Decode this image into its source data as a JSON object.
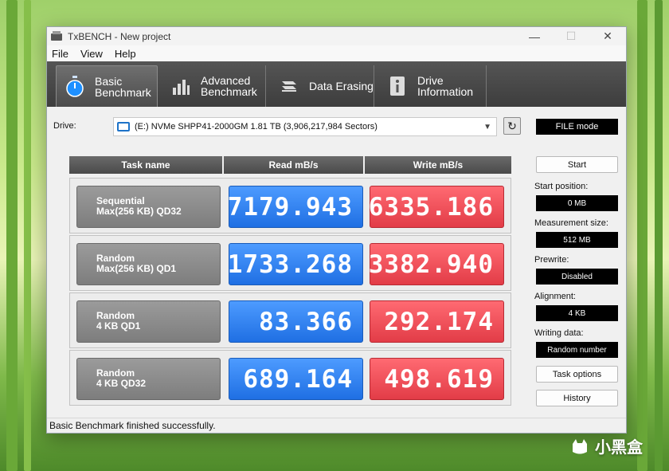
{
  "window": {
    "title": "TxBENCH - New project"
  },
  "menu": [
    "File",
    "View",
    "Help"
  ],
  "tabs": [
    {
      "line1": "Basic",
      "line2": "Benchmark",
      "icon": "stopwatch-icon",
      "active": true
    },
    {
      "line1": "Advanced",
      "line2": "Benchmark",
      "icon": "bar-chart-icon",
      "active": false
    },
    {
      "line1": "Data Erasing",
      "line2": "",
      "icon": "eraser-icon",
      "active": false
    },
    {
      "line1": "Drive",
      "line2": "Information",
      "icon": "info-icon",
      "active": false
    }
  ],
  "drive": {
    "label": "Drive:",
    "selected": "(E:) NVMe SHPP41-2000GM  1.81 TB (3,906,217,984 Sectors)"
  },
  "mode": "FILE mode",
  "table": {
    "headers": [
      "Task name",
      "Read mB/s",
      "Write mB/s"
    ],
    "rows": [
      {
        "task_line1": "Sequential",
        "task_line2": "Max(256 KB) QD32",
        "read": "7179.943",
        "write": "6335.186"
      },
      {
        "task_line1": "Random",
        "task_line2": "Max(256 KB) QD1",
        "read": "1733.268",
        "write": "3382.940"
      },
      {
        "task_line1": "Random",
        "task_line2": "4 KB QD1",
        "read": "83.366",
        "write": "292.174"
      },
      {
        "task_line1": "Random",
        "task_line2": "4 KB QD32",
        "read": "689.164",
        "write": "498.619"
      }
    ]
  },
  "side": {
    "start": "Start",
    "start_position_label": "Start position:",
    "start_position": "0 MB",
    "measurement_size_label": "Measurement size:",
    "measurement_size": "512 MB",
    "prewrite_label": "Prewrite:",
    "prewrite": "Disabled",
    "alignment_label": "Alignment:",
    "alignment": "4 KB",
    "writing_data_label": "Writing data:",
    "writing_data": "Random number",
    "task_options": "Task options",
    "history": "History"
  },
  "status": "Basic Benchmark finished successfully.",
  "watermark": "小黑盒",
  "colors": {
    "read": "#2a7ff0",
    "write": "#ec4b55",
    "toolbar": "#4a4a4a"
  }
}
